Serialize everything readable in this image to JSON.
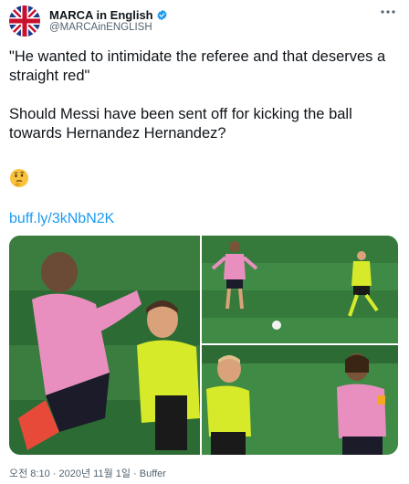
{
  "account": {
    "name": "MARCA in English",
    "handle": "@MARCAinENGLISH",
    "verified": true
  },
  "tweet": {
    "text": "\"He wanted to intimidate the referee and that deserves a straight red\"\n\nShould Messi have been sent off for kicking the ball towards Hernandez Hernandez?",
    "emoji": "thinking-face",
    "link": "buff.ly/3kNbN2K"
  },
  "media": {
    "panels": [
      "player-and-referee-closeup",
      "player-kicking-ball",
      "referee-and-messi"
    ]
  },
  "meta": {
    "time": "오전 8:10",
    "separator1": "·",
    "date": "2020년 11월 1일",
    "separator2": "·",
    "source": "Buffer"
  },
  "colors": {
    "link": "#1d9bf0",
    "verified": "#1d9bf0",
    "pitch": "#2f7a3a",
    "barca_pink": "#e88fc0",
    "referee_yellow": "#d7ea2a"
  }
}
